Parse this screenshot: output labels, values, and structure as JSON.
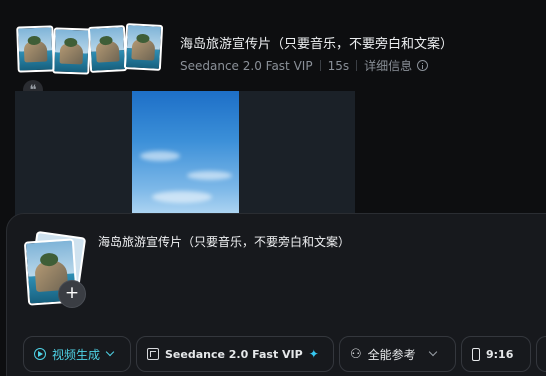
{
  "task": {
    "title": "海岛旅游宣传片（只要音乐，不要旁白和文案）",
    "model": "Seedance 2.0 Fast VIP",
    "duration": "15s",
    "details_link": "详细信息",
    "quote_icon": "quote-icon",
    "info_icon": "info-icon"
  },
  "composer": {
    "prompt": "海岛旅游宣传片（只要音乐，不要旁白和文案）",
    "add_label": "+",
    "toolbar": {
      "mode": "视频生成",
      "model": "Seedance 2.0 Fast VIP",
      "reference": "全能参考",
      "ratio": "9:16"
    }
  },
  "colors": {
    "accent": "#4fd2e6",
    "sparkle": "#36c7f0",
    "background": "#0d0e10",
    "panel": "#17191d"
  }
}
